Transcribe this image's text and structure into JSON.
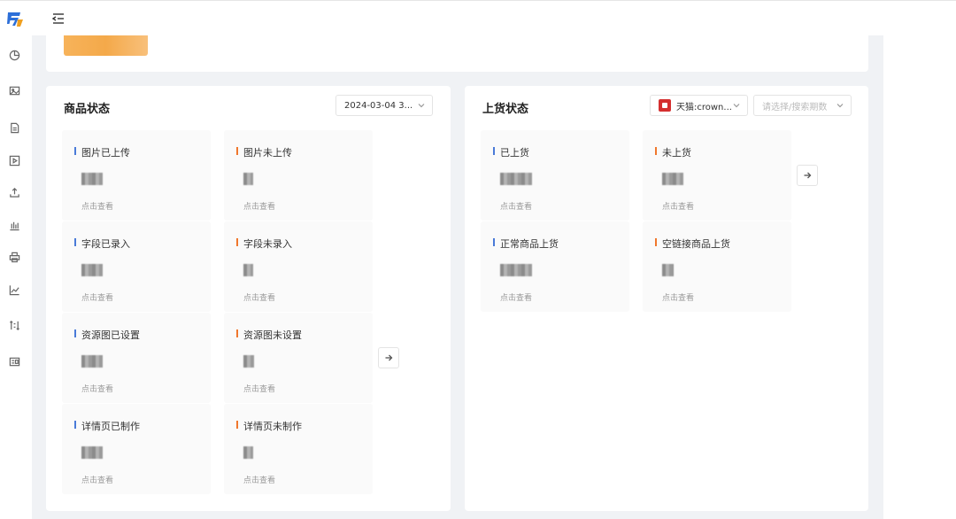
{
  "brand_color": "#2d6fd8",
  "accent_orange": "#f0772d",
  "accent_blue": "#4a7ad8",
  "sidebar": {
    "icons": [
      "pie-chart-icon",
      "image-icon",
      "document-icon",
      "video-icon",
      "upload-icon",
      "bar-chart-icon",
      "printer-icon",
      "line-chart-icon",
      "transfer-icon",
      "image-text-icon"
    ]
  },
  "product_status": {
    "title": "商品状态",
    "date_select": "2024-03-04 3...",
    "cards": [
      {
        "label": "图片已上传",
        "link": "点击查看"
      },
      {
        "label": "图片未上传",
        "link": "点击查看"
      },
      {
        "label": "字段已录入",
        "link": "点击查看"
      },
      {
        "label": "字段未录入",
        "link": "点击查看"
      },
      {
        "label": "资源图已设置",
        "link": "点击查看"
      },
      {
        "label": "资源图未设置",
        "link": "点击查看"
      },
      {
        "label": "详情页已制作",
        "link": "点击查看"
      },
      {
        "label": "详情页未制作",
        "link": "点击查看"
      }
    ]
  },
  "listing_status": {
    "title": "上货状态",
    "shop_select": "天猫:crown...",
    "period_placeholder": "请选择/搜索期数",
    "cards": [
      {
        "label": "已上货",
        "link": "点击查看"
      },
      {
        "label": "未上货",
        "link": "点击查看"
      },
      {
        "label": "正常商品上货",
        "link": "点击查看"
      },
      {
        "label": "空链接商品上货",
        "link": "点击查看"
      }
    ]
  }
}
